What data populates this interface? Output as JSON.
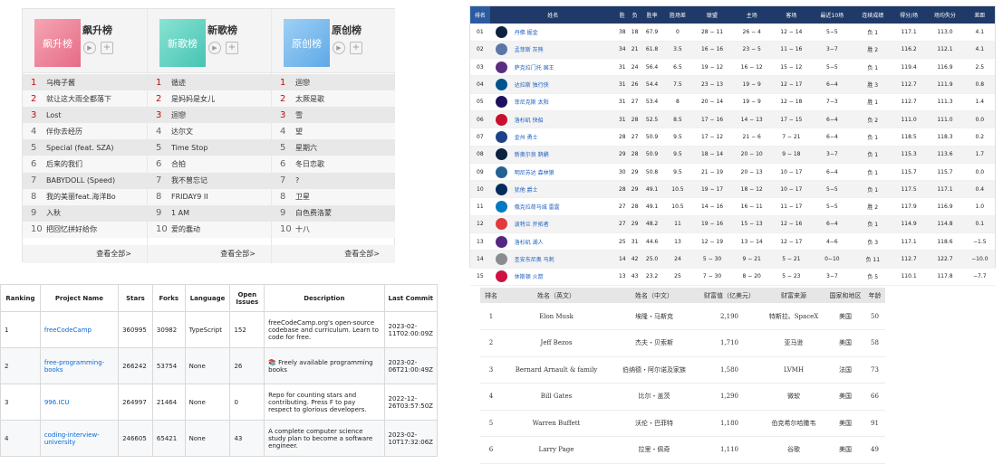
{
  "music": {
    "more_label": "查看全部>",
    "lists": [
      {
        "title": "飙升榜",
        "cover": "飙升榜",
        "theme": "red",
        "items": [
          "乌梅子酱",
          "就让这大雨全都落下",
          "Lost",
          "伴你去经历",
          "Special (feat. SZA)",
          "后来的我们",
          "BABYDOLL (Speed)",
          "我的美丽feat.海洋Bo",
          "入秋",
          "把回忆拼好给你"
        ]
      },
      {
        "title": "新歌榜",
        "cover": "新歌榜",
        "theme": "teal",
        "items": [
          "循迹",
          "是妈妈是女儿",
          "迴戀",
          "达尔文",
          "Time Stop",
          "合拍",
          "我不曾忘记",
          "FRIDAY9 II",
          "1 AM",
          "爱的蠢动"
        ]
      },
      {
        "title": "原创榜",
        "cover": "原创榜",
        "theme": "blue",
        "items": [
          "迴戀",
          "太厥是歌",
          "雪",
          "望",
          "星期六",
          "冬日恋歌",
          "?",
          "卫星",
          "白色费洛蒙",
          "十八"
        ]
      }
    ]
  },
  "nba": {
    "headers": [
      "排名",
      "姓名",
      "胜",
      "负",
      "胜率",
      "胜场差",
      "联盟",
      "主场",
      "客场",
      "最近10场",
      "连续成绩",
      "得分/场",
      "场均失分",
      "差距"
    ],
    "rows": [
      {
        "rank": "01",
        "team": "丹佛 掘金",
        "w": "38",
        "l": "18",
        "pct": "67.9",
        "gb": "0",
        "conf": "28 − 11",
        "home": "26 − 4",
        "away": "12 − 14",
        "last10": "5−5",
        "streak": "负 1",
        "ppg": "117.1",
        "opp": "113.0",
        "diff": "4.1",
        "color": "#0e2240"
      },
      {
        "rank": "02",
        "team": "孟菲斯 灰熊",
        "w": "34",
        "l": "21",
        "pct": "61.8",
        "gb": "3.5",
        "conf": "16 − 16",
        "home": "23 − 5",
        "away": "11 − 16",
        "last10": "3−7",
        "streak": "胜 2",
        "ppg": "116.2",
        "opp": "112.1",
        "diff": "4.1",
        "color": "#5d76a9"
      },
      {
        "rank": "03",
        "team": "萨克拉门托 国王",
        "w": "31",
        "l": "24",
        "pct": "56.4",
        "gb": "6.5",
        "conf": "19 − 12",
        "home": "16 − 12",
        "away": "15 − 12",
        "last10": "5−5",
        "streak": "负 1",
        "ppg": "119.4",
        "opp": "116.9",
        "diff": "2.5",
        "color": "#5a2d81"
      },
      {
        "rank": "04",
        "team": "达拉斯 独行侠",
        "w": "31",
        "l": "26",
        "pct": "54.4",
        "gb": "7.5",
        "conf": "23 − 13",
        "home": "19 − 9",
        "away": "12 − 17",
        "last10": "6−4",
        "streak": "胜 3",
        "ppg": "112.7",
        "opp": "111.9",
        "diff": "0.8",
        "color": "#00538c"
      },
      {
        "rank": "05",
        "team": "菲尼克斯 太阳",
        "w": "31",
        "l": "27",
        "pct": "53.4",
        "gb": "8",
        "conf": "20 − 14",
        "home": "19 − 9",
        "away": "12 − 18",
        "last10": "7−3",
        "streak": "胜 1",
        "ppg": "112.7",
        "opp": "111.3",
        "diff": "1.4",
        "color": "#1d1160"
      },
      {
        "rank": "06",
        "team": "洛杉矶 快船",
        "w": "31",
        "l": "28",
        "pct": "52.5",
        "gb": "8.5",
        "conf": "17 − 16",
        "home": "14 − 13",
        "away": "17 − 15",
        "last10": "6−4",
        "streak": "负 2",
        "ppg": "111.0",
        "opp": "111.0",
        "diff": "0.0",
        "color": "#c8102e"
      },
      {
        "rank": "07",
        "team": "金州 勇士",
        "w": "28",
        "l": "27",
        "pct": "50.9",
        "gb": "9.5",
        "conf": "17 − 12",
        "home": "21 − 6",
        "away": "7 − 21",
        "last10": "6−4",
        "streak": "负 1",
        "ppg": "118.5",
        "opp": "118.3",
        "diff": "0.2",
        "color": "#1d428a"
      },
      {
        "rank": "08",
        "team": "新奥尔良 鹈鹕",
        "w": "29",
        "l": "28",
        "pct": "50.9",
        "gb": "9.5",
        "conf": "18 − 14",
        "home": "20 − 10",
        "away": "9 − 18",
        "last10": "3−7",
        "streak": "负 1",
        "ppg": "115.3",
        "opp": "113.6",
        "diff": "1.7",
        "color": "#0c2340"
      },
      {
        "rank": "09",
        "team": "明尼苏达 森林狼",
        "w": "30",
        "l": "29",
        "pct": "50.8",
        "gb": "9.5",
        "conf": "21 − 19",
        "home": "20 − 13",
        "away": "10 − 17",
        "last10": "6−4",
        "streak": "负 1",
        "ppg": "115.7",
        "opp": "115.7",
        "diff": "0.0",
        "color": "#236192"
      },
      {
        "rank": "10",
        "team": "犹他 爵士",
        "w": "28",
        "l": "29",
        "pct": "49.1",
        "gb": "10.5",
        "conf": "19 − 17",
        "home": "18 − 12",
        "away": "10 − 17",
        "last10": "5−5",
        "streak": "负 1",
        "ppg": "117.5",
        "opp": "117.1",
        "diff": "0.4",
        "color": "#002b5c"
      },
      {
        "rank": "11",
        "team": "俄克拉荷马城 雷霆",
        "w": "27",
        "l": "28",
        "pct": "49.1",
        "gb": "10.5",
        "conf": "14 − 16",
        "home": "16 − 11",
        "away": "11 − 17",
        "last10": "5−5",
        "streak": "胜 2",
        "ppg": "117.9",
        "opp": "116.9",
        "diff": "1.0",
        "color": "#007ac1"
      },
      {
        "rank": "12",
        "team": "波特兰 开拓者",
        "w": "27",
        "l": "29",
        "pct": "48.2",
        "gb": "11",
        "conf": "19 − 16",
        "home": "15 − 13",
        "away": "12 − 16",
        "last10": "6−4",
        "streak": "负 1",
        "ppg": "114.9",
        "opp": "114.8",
        "diff": "0.1",
        "color": "#e03a3e"
      },
      {
        "rank": "13",
        "team": "洛杉矶 湖人",
        "w": "25",
        "l": "31",
        "pct": "44.6",
        "gb": "13",
        "conf": "12 − 19",
        "home": "13 − 14",
        "away": "12 − 17",
        "last10": "4−6",
        "streak": "负 3",
        "ppg": "117.1",
        "opp": "118.6",
        "diff": "−1.5",
        "color": "#552583"
      },
      {
        "rank": "14",
        "team": "圣安东尼奥 马刺",
        "w": "14",
        "l": "42",
        "pct": "25.0",
        "gb": "24",
        "conf": "5 − 30",
        "home": "9 − 21",
        "away": "5 − 21",
        "last10": "0−10",
        "streak": "负 11",
        "ppg": "112.7",
        "opp": "122.7",
        "diff": "−10.0",
        "color": "#8a8d8f"
      },
      {
        "rank": "15",
        "team": "休斯顿 火箭",
        "w": "13",
        "l": "43",
        "pct": "23.2",
        "gb": "25",
        "conf": "7 − 30",
        "home": "8 − 20",
        "away": "5 − 23",
        "last10": "3−7",
        "streak": "负 5",
        "ppg": "110.1",
        "opp": "117.8",
        "diff": "−7.7",
        "color": "#ce1141"
      }
    ]
  },
  "github": {
    "headers": [
      "Ranking",
      "Project Name",
      "Stars",
      "Forks",
      "Language",
      "Open Issues",
      "Description",
      "Last Commit"
    ],
    "rows": [
      {
        "rank": "1",
        "name": "freeCodeCamp",
        "stars": "360995",
        "forks": "30982",
        "lang": "TypeScript",
        "issues": "152",
        "desc": "freeCodeCamp.org's open-source codebase and curriculum. Learn to code for free.",
        "commit": "2023-02-11T02:00:09Z"
      },
      {
        "rank": "2",
        "name": "free-programming-books",
        "stars": "266242",
        "forks": "53754",
        "lang": "None",
        "issues": "26",
        "desc": "📚 Freely available programming books",
        "commit": "2023-02-06T21:00:49Z"
      },
      {
        "rank": "3",
        "name": "996.ICU",
        "stars": "264997",
        "forks": "21464",
        "lang": "None",
        "issues": "0",
        "desc": "Repo for counting stars and contributing. Press F to pay respect to glorious developers.",
        "commit": "2022-12-26T03:57:50Z"
      },
      {
        "rank": "4",
        "name": "coding-interview-university",
        "stars": "246605",
        "forks": "65421",
        "lang": "None",
        "issues": "43",
        "desc": "A complete computer science study plan to become a software engineer.",
        "commit": "2023-02-10T17:32:06Z"
      }
    ]
  },
  "rich": {
    "headers": [
      "排名",
      "姓名（英文）",
      "姓名（中文）",
      "财富值（亿美元）",
      "财富来源",
      "国家和地区",
      "年龄"
    ],
    "rows": [
      {
        "rank": "1",
        "en": "Elon Musk",
        "cn": "埃隆・马斯克",
        "wealth": "2,190",
        "source": "特斯拉、SpaceX",
        "country": "美国",
        "age": "50"
      },
      {
        "rank": "2",
        "en": "Jeff Bezos",
        "cn": "杰夫・贝索斯",
        "wealth": "1,710",
        "source": "亚马逊",
        "country": "美国",
        "age": "58"
      },
      {
        "rank": "3",
        "en": "Bernard Arnault & family",
        "cn": "伯纳德・阿尔诺及家族",
        "wealth": "1,580",
        "source": "LVMH",
        "country": "法国",
        "age": "73"
      },
      {
        "rank": "4",
        "en": "Bill Gates",
        "cn": "比尔・盖茨",
        "wealth": "1,290",
        "source": "微软",
        "country": "美国",
        "age": "66"
      },
      {
        "rank": "5",
        "en": "Warren Buffett",
        "cn": "沃伦・巴菲特",
        "wealth": "1,180",
        "source": "伯克希尔哈撒韦",
        "country": "美国",
        "age": "91"
      },
      {
        "rank": "6",
        "en": "Larry Page",
        "cn": "拉里・佩奇",
        "wealth": "1,110",
        "source": "谷歌",
        "country": "美国",
        "age": "49"
      }
    ]
  }
}
